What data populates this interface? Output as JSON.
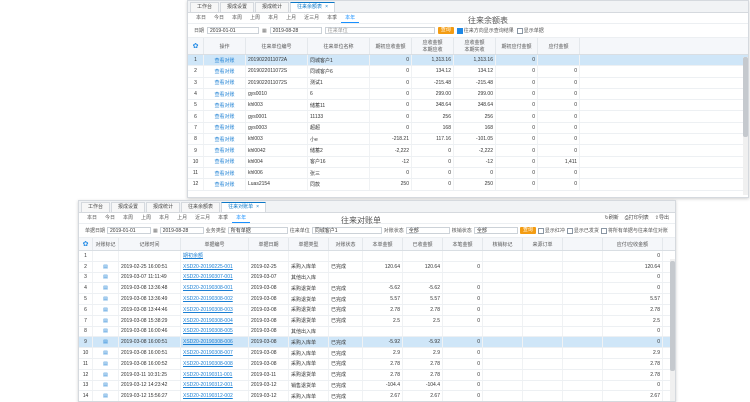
{
  "win1": {
    "tabs": [
      {
        "label": "工作台",
        "active": false
      },
      {
        "label": "报成设置",
        "active": false
      },
      {
        "label": "报成统计",
        "active": false
      },
      {
        "label": "往来余额表",
        "active": true
      }
    ],
    "periods": [
      "本日",
      "今日",
      "本周",
      "上周",
      "本月",
      "上月",
      "近三月",
      "本季",
      "本年"
    ],
    "title": "往来余额表",
    "filter": {
      "date_label": "日期",
      "date_from": "2019-01-01",
      "date_to": "2019-08-28",
      "unit_placeholder": "往来单位",
      "query": "查询",
      "opt1": "往来方向显示查询结果",
      "opt2": "显示单据"
    },
    "headers": [
      "",
      "操作",
      "往来单位编号",
      "往来单位名称",
      "期初应收金额",
      "应收金额\n本期应收",
      "应收金额\n本期实收",
      "期初应付金额",
      "应付金额"
    ],
    "rows": [
      {
        "n": "1",
        "code": "2019022011072A",
        "name": "同城客户1",
        "c1": "0",
        "c2": "1,313.16",
        "c3": "1,313.16",
        "c4": "0",
        "c5": "",
        "sel": true
      },
      {
        "n": "2",
        "code": "2019022011072S",
        "name": "同城客户6",
        "c1": "0",
        "c2": "134.12",
        "c3": "134.12",
        "c4": "0",
        "c5": "0",
        "sel": false
      },
      {
        "n": "3",
        "code": "2019022011072S",
        "name": "测试1",
        "c1": "0",
        "c2": "-215.48",
        "c3": "-215.48",
        "c4": "0",
        "c5": "0",
        "sel": false
      },
      {
        "n": "4",
        "code": "gys0010",
        "name": "6",
        "c1": "0",
        "c2": "299.00",
        "c3": "299.00",
        "c4": "0",
        "c5": "0",
        "sel": false
      },
      {
        "n": "5",
        "code": "khl003",
        "name": "储蓄11",
        "c1": "0",
        "c2": "348.64",
        "c3": "348.64",
        "c4": "0",
        "c5": "0",
        "sel": false
      },
      {
        "n": "6",
        "code": "gys0001",
        "name": "11133",
        "c1": "0",
        "c2": "256",
        "c3": "256",
        "c4": "0",
        "c5": "0",
        "sel": false
      },
      {
        "n": "7",
        "code": "gys0003",
        "name": "超超",
        "c1": "0",
        "c2": "168",
        "c3": "168",
        "c4": "0",
        "c5": "0",
        "sel": false
      },
      {
        "n": "8",
        "code": "khl003",
        "name": "小e",
        "c1": "-218.21",
        "c2": "117.16",
        "c3": "-101.05",
        "c4": "0",
        "c5": "0",
        "sel": false
      },
      {
        "n": "9",
        "code": "khl0042",
        "name": "储蓄2",
        "c1": "-2,222",
        "c2": "0",
        "c3": "-2,222",
        "c4": "0",
        "c5": "0",
        "sel": false
      },
      {
        "n": "10",
        "code": "khl004",
        "name": "客户16",
        "c1": "-12",
        "c2": "0",
        "c3": "-12",
        "c4": "0",
        "c5": "1,411",
        "sel": false
      },
      {
        "n": "11",
        "code": "khl006",
        "name": "张三",
        "c1": "0",
        "c2": "0",
        "c3": "0",
        "c4": "0",
        "c5": "0",
        "sel": false
      },
      {
        "n": "12",
        "code": "Luas2154",
        "name": "同款",
        "c1": "250",
        "c2": "0",
        "c3": "250",
        "c4": "0",
        "c5": "0",
        "sel": false
      }
    ],
    "action_view": "查看",
    "action_check": "对账"
  },
  "win2": {
    "tabs": [
      {
        "label": "工作台",
        "active": false
      },
      {
        "label": "报成设置",
        "active": false
      },
      {
        "label": "报成统计",
        "active": false
      },
      {
        "label": "往来余额表",
        "active": false
      },
      {
        "label": "往来对账单",
        "active": true
      }
    ],
    "periods": [
      "本日",
      "今日",
      "本周",
      "上周",
      "本月",
      "上月",
      "近三月",
      "本季",
      "本年"
    ],
    "title": "往来对账单",
    "tools": [
      "刷新",
      "打印列表",
      "导出"
    ],
    "filter": {
      "date_label": "单据日期",
      "date_from": "2019-01-01",
      "date_to": "2019-08-28",
      "type_label": "业务类型",
      "type_value": "所有单据",
      "unit_label": "往来单位",
      "unit_value": "同城客户1",
      "status_label": "对账状态",
      "status_value": "全部",
      "verify_label": "核销状态",
      "verify_value": "全部",
      "query": "查询",
      "opt1": "显示红冲",
      "opt2": "显示已发货",
      "opt3": "将所有单据与往来单位对账"
    },
    "headers": [
      "",
      "对账标记",
      "记账时间",
      "单据编号",
      "单据日期",
      "单据类型",
      "对账状态",
      "本单金额",
      "已收金额",
      "本笔金额",
      "核销标记",
      "来源订单",
      "",
      "应付/应收金额"
    ],
    "rows": [
      {
        "n": "1",
        "time": "",
        "code": "期初余额",
        "date": "",
        "type": "",
        "st": "",
        "a1": "",
        "a2": "",
        "a3": "",
        "bal": "0",
        "sel": false
      },
      {
        "n": "2",
        "time": "2019-02-25 16:00:51",
        "code": "XSD20-20190225-001",
        "date": "2019-02-25",
        "type": "采购入库单",
        "st": "已完成",
        "a1": "120.64",
        "a2": "120.64",
        "a3": "0",
        "bal": "120.64",
        "sel": false
      },
      {
        "n": "3",
        "time": "2019-03-07 11:11:49",
        "code": "XSD20-20190307-001",
        "date": "2019-03-07",
        "type": "其他出入库",
        "st": "",
        "a1": "",
        "a2": "",
        "a3": "",
        "bal": "0",
        "sel": false
      },
      {
        "n": "4",
        "time": "2019-03-08 13:36:48",
        "code": "XSD20-20190308-001",
        "date": "2019-03-08",
        "type": "采购退货单",
        "st": "已完成",
        "a1": "-5.62",
        "a2": "-5.62",
        "a3": "0",
        "bal": "0",
        "sel": false
      },
      {
        "n": "5",
        "time": "2019-03-08 13:36:49",
        "code": "XSD20-20190308-002",
        "date": "2019-03-08",
        "type": "采购退货单",
        "st": "已完成",
        "a1": "5.57",
        "a2": "5.57",
        "a3": "0",
        "bal": "5.57",
        "sel": false
      },
      {
        "n": "6",
        "time": "2019-03-08 13:44:46",
        "code": "XSD20-20190308-003",
        "date": "2019-03-08",
        "type": "采购退货单",
        "st": "已完成",
        "a1": "2.78",
        "a2": "2.78",
        "a3": "0",
        "bal": "2.78",
        "sel": false
      },
      {
        "n": "7",
        "time": "2019-03-08 15:38:29",
        "code": "XSD20-20190308-004",
        "date": "2019-03-08",
        "type": "采购退货单",
        "st": "已完成",
        "a1": "2.5",
        "a2": "2.5",
        "a3": "0",
        "bal": "2.5",
        "sel": false
      },
      {
        "n": "8",
        "time": "2019-03-08 16:00:46",
        "code": "XSD20-20190308-005",
        "date": "2019-03-08",
        "type": "其他出入库",
        "st": "",
        "a1": "",
        "a2": "",
        "a3": "",
        "bal": "0",
        "sel": false
      },
      {
        "n": "9",
        "time": "2019-03-08 16:00:51",
        "code": "XSD20-20190308-006",
        "date": "2019-03-08",
        "type": "采购入库单",
        "st": "已完成",
        "a1": "-5.92",
        "a2": "-5.92",
        "a3": "0",
        "bal": "0",
        "sel": true
      },
      {
        "n": "10",
        "time": "2019-03-08 16:00:51",
        "code": "XSD20-20190308-007",
        "date": "2019-03-08",
        "type": "采购入库单",
        "st": "已完成",
        "a1": "2.9",
        "a2": "2.9",
        "a3": "0",
        "bal": "2.9",
        "sel": false
      },
      {
        "n": "11",
        "time": "2019-03-08 16:00:52",
        "code": "XSD20-20190308-008",
        "date": "2019-03-08",
        "type": "采购入库单",
        "st": "已完成",
        "a1": "2.78",
        "a2": "2.78",
        "a3": "0",
        "bal": "2.78",
        "sel": false
      },
      {
        "n": "12",
        "time": "2019-03-11 10:31:25",
        "code": "XSD20-20190311-001",
        "date": "2019-03-11",
        "type": "采购退货单",
        "st": "已完成",
        "a1": "2.78",
        "a2": "2.78",
        "a3": "0",
        "bal": "2.78",
        "sel": false
      },
      {
        "n": "13",
        "time": "2019-03-12 14:23:42",
        "code": "XSD20-20190312-001",
        "date": "2019-03-12",
        "type": "销售退货单",
        "st": "已完成",
        "a1": "-104.4",
        "a2": "-104.4",
        "a3": "0",
        "bal": "0",
        "sel": false
      },
      {
        "n": "14",
        "time": "2019-03-12 15:56:27",
        "code": "XSD20-20190312-002",
        "date": "2019-03-12",
        "type": "采购入库单",
        "st": "已完成",
        "a1": "2.67",
        "a2": "2.67",
        "a3": "0",
        "bal": "2.67",
        "sel": false
      }
    ]
  }
}
